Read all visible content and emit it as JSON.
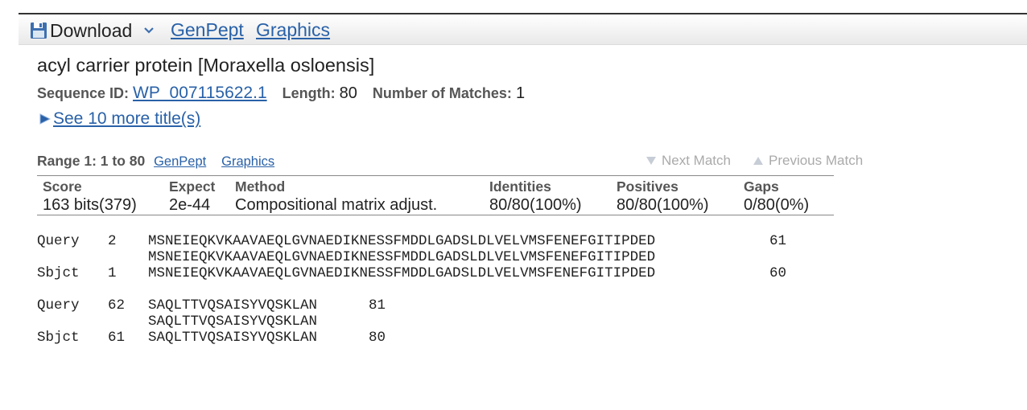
{
  "toolbar": {
    "download_label": "Download",
    "links": [
      "GenPept",
      "Graphics"
    ]
  },
  "hit": {
    "title": "acyl carrier protein [Moraxella osloensis]",
    "sequence_id_label": "Sequence ID:",
    "sequence_id": "WP_007115622.1",
    "length_label": "Length:",
    "length": "80",
    "matches_label": "Number of Matches:",
    "matches": "1",
    "see_more": "See 10 more title(s)"
  },
  "range": {
    "label": "Range 1: 1 to 80",
    "links": [
      "GenPept",
      "Graphics"
    ],
    "next_match": "Next Match",
    "previous_match": "Previous Match"
  },
  "stats": {
    "headers": [
      "Score",
      "Expect",
      "Method",
      "Identities",
      "Positives",
      "Gaps"
    ],
    "values": [
      "163 bits(379)",
      "2e-44",
      "Compositional matrix adjust.",
      "80/80(100%)",
      "80/80(100%)",
      "0/80(0%)"
    ]
  },
  "alignment": [
    {
      "query": {
        "label": "Query",
        "start": "2",
        "seq": "MSNEIEQKVKAAVAEQLGVNAEDIKNESSFMDDLGADSLDLVELVMSFENEFGITIPDED",
        "end": "61"
      },
      "match": "MSNEIEQKVKAAVAEQLGVNAEDIKNESSFMDDLGADSLDLVELVMSFENEFGITIPDED",
      "sbjct": {
        "label": "Sbjct",
        "start": "1",
        "seq": "MSNEIEQKVKAAVAEQLGVNAEDIKNESSFMDDLGADSLDLVELVMSFENEFGITIPDED",
        "end": "60"
      }
    },
    {
      "query": {
        "label": "Query",
        "start": "62",
        "seq": "SAQLTTVQSAISYVQSKLAN",
        "end": "81"
      },
      "match": "SAQLTTVQSAISYVQSKLAN",
      "sbjct": {
        "label": "Sbjct",
        "start": "61",
        "seq": "SAQLTTVQSAISYVQSKLAN",
        "end": "80"
      }
    }
  ],
  "colors": {
    "link": "#2961a8",
    "disabled": "#aaaaaa",
    "label": "#555555",
    "icon_blue": "#3d6fb0"
  },
  "icons": [
    "floppy-disk-icon",
    "chevron-down-icon",
    "expand-triangle-icon",
    "arrow-down-icon",
    "arrow-up-icon"
  ]
}
